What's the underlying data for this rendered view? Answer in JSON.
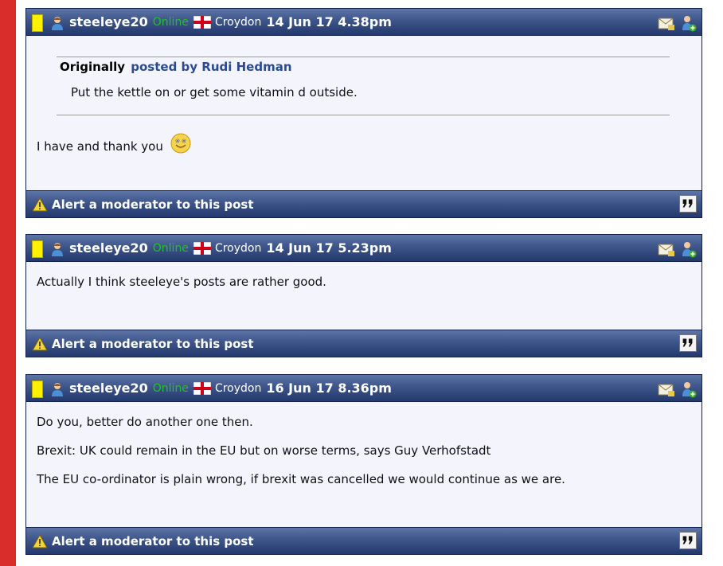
{
  "posts": [
    {
      "username": "steeleye20",
      "status": "Online",
      "location": "Croydon",
      "date": "14 Jun 17 4.38pm",
      "quote": {
        "originally": "Originally",
        "posted_by": "posted by Rudi Hedman",
        "text": "Put the kettle on or get some vitamin d outside."
      },
      "lines": [
        "I have and thank you"
      ],
      "smiley": "smiley-icon",
      "alert_label": "Alert a moderator to this post"
    },
    {
      "username": "steeleye20",
      "status": "Online",
      "location": "Croydon",
      "date": "14 Jun 17 5.23pm",
      "lines": [
        "Actually I think steeleye's posts are rather good."
      ],
      "alert_label": "Alert a moderator to this post"
    },
    {
      "username": "steeleye20",
      "status": "Online",
      "location": "Croydon",
      "date": "16 Jun 17 8.36pm",
      "lines": [
        "Do you, better do another one then.",
        "Brexit: UK could remain in the EU but on worse terms, says Guy Verhofstadt",
        "The EU co-ordinator is plain wrong, if brexit was cancelled we would continue as we are."
      ],
      "alert_label": "Alert a moderator to this post"
    }
  ],
  "icons": {
    "user": "user-icon",
    "flag": "england-flag-icon",
    "pm": "private-message-icon",
    "add_friend": "add-friend-icon",
    "warning": "warning-icon",
    "quote": "quote-icon"
  },
  "colors": {
    "header_blue": "#3d5589",
    "online_green": "#1fc31f",
    "body_bg": "#f3f4fc",
    "side_red": "#d82d2a",
    "status_yellow": "#ffef00"
  }
}
